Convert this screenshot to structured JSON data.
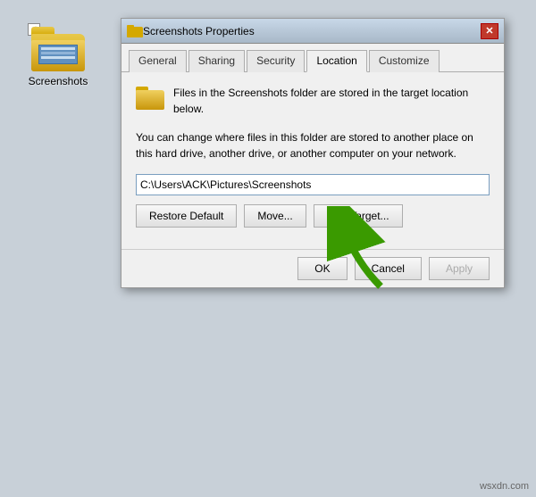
{
  "desktop": {
    "icon_label": "Screenshots",
    "checkbox_symbol": "✓"
  },
  "dialog": {
    "title": "Screenshots Properties",
    "tabs": [
      {
        "id": "general",
        "label": "General"
      },
      {
        "id": "sharing",
        "label": "Sharing"
      },
      {
        "id": "security",
        "label": "Security"
      },
      {
        "id": "location",
        "label": "Location"
      },
      {
        "id": "customize",
        "label": "Customize"
      }
    ],
    "active_tab": "location",
    "info_text": "Files in the Screenshots folder are stored in the target location below.",
    "description_text": "You can change where files in this folder are stored to another place on this hard drive, another drive, or another computer on your network.",
    "path_value": "C:\\Users\\ACK\\Pictures\\Screenshots",
    "buttons": {
      "restore_default": "Restore Default",
      "move": "Move...",
      "find_target": "Find Target..."
    },
    "footer": {
      "ok": "OK",
      "cancel": "Cancel",
      "apply": "Apply"
    }
  },
  "watermark": {
    "text": "wsxdn.com"
  }
}
